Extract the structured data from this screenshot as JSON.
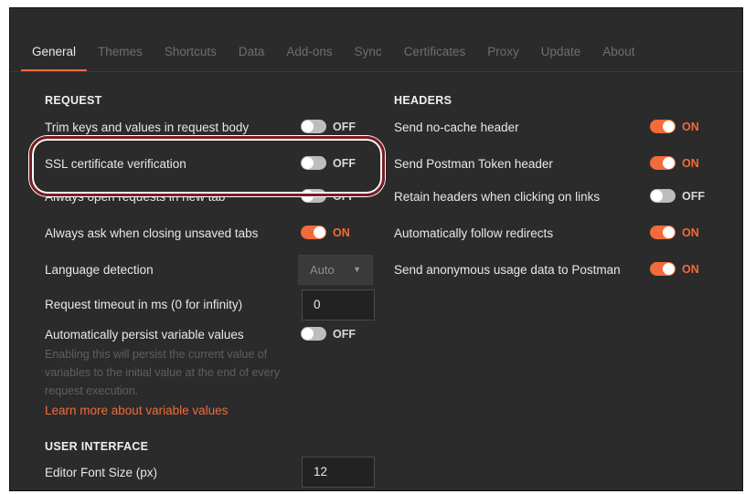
{
  "tabs": [
    "General",
    "Themes",
    "Shortcuts",
    "Data",
    "Add-ons",
    "Sync",
    "Certificates",
    "Proxy",
    "Update",
    "About"
  ],
  "request": {
    "title": "REQUEST",
    "trim": {
      "label": "Trim keys and values in request body",
      "state": "OFF"
    },
    "ssl": {
      "label": "SSL certificate verification",
      "state": "OFF"
    },
    "new_tab": {
      "label": "Always open requests in new tab",
      "state": "OFF"
    },
    "ask_close": {
      "label": "Always ask when closing unsaved tabs",
      "state": "ON"
    },
    "language": {
      "label": "Language detection",
      "value": "Auto"
    },
    "timeout": {
      "label": "Request timeout in ms (0 for infinity)",
      "value": "0"
    },
    "persist": {
      "label": "Automatically persist variable values",
      "state": "OFF",
      "helper": "Enabling this will persist the current value of variables to the initial value at the end of every request execution.",
      "link": "Learn more about variable values"
    }
  },
  "ui": {
    "title": "USER INTERFACE",
    "font_size": {
      "label": "Editor Font Size (px)",
      "value": "12"
    }
  },
  "headers": {
    "title": "HEADERS",
    "no_cache": {
      "label": "Send no-cache header",
      "state": "ON"
    },
    "postman_token": {
      "label": "Send Postman Token header",
      "state": "ON"
    },
    "retain": {
      "label": "Retain headers when clicking on links",
      "state": "OFF"
    },
    "redirects": {
      "label": "Automatically follow redirects",
      "state": "ON"
    },
    "anonymous": {
      "label": "Send anonymous usage data to Postman",
      "state": "ON"
    }
  },
  "colors": {
    "accent": "#f26b3a",
    "background": "#2b2b2b",
    "highlight": "#7c1d24"
  }
}
